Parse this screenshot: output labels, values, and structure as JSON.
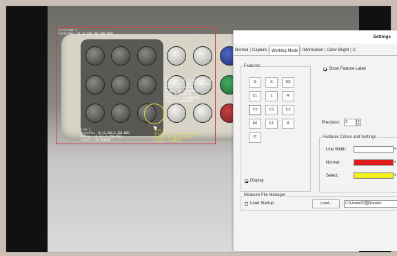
{
  "overlay": {
    "top_left": "CircleLab 1\nCenterPos: (0.12,400,500,400,800)",
    "mid_right": "Rect 1\nStartPos: (0.13,450,0.145,54)\nEndPos: (0.1,462,0.1,461,84)\nWidth: 110.000000\nHeight: 60.00000000\nArea: 0.00000000\nPerimeter: 0.00000000\nAngle: 0.00000000",
    "bottom_left": "Line 1\nStartPos: (0.12,400,0.160,888)\nEndPos: (0.131,0,450,888)\nLength: 110.000000",
    "bottom_center": "Line 2\nStartPos: (0.16,0,1,100,888)\nEndPos: (0.14,0,0,0,0)\nLength: 0.000000"
  },
  "dialog": {
    "title": "Settings",
    "tabs": [
      "Normal",
      "Capture",
      "Working Mode",
      "Information",
      "Color Bright",
      "C"
    ],
    "features_label": "Features",
    "feature_keys": [
      "S",
      "X",
      "XX",
      "CL",
      "L",
      "R",
      "C0",
      "C1",
      "C2",
      "E0",
      "E1",
      "A",
      "P"
    ],
    "display_label": "Display",
    "show_feature_label": "Show Feature Label",
    "precision_label": "Precision:",
    "precision_value": "3",
    "colors_label": "Features Colors and Settings",
    "line_width_label": "Line Width:",
    "normal_label": "Normal:",
    "select_label": "Select:",
    "measure_file_manager_label": "Measure File Manager",
    "load_startup_label": "Load Startup",
    "load_button": "Load...",
    "path_value": "C:\\Users\\中国\\Deskto"
  },
  "colors": {
    "normal": "#e01a1a",
    "select": "#f2ef1c",
    "line_width": "#ffffff"
  }
}
